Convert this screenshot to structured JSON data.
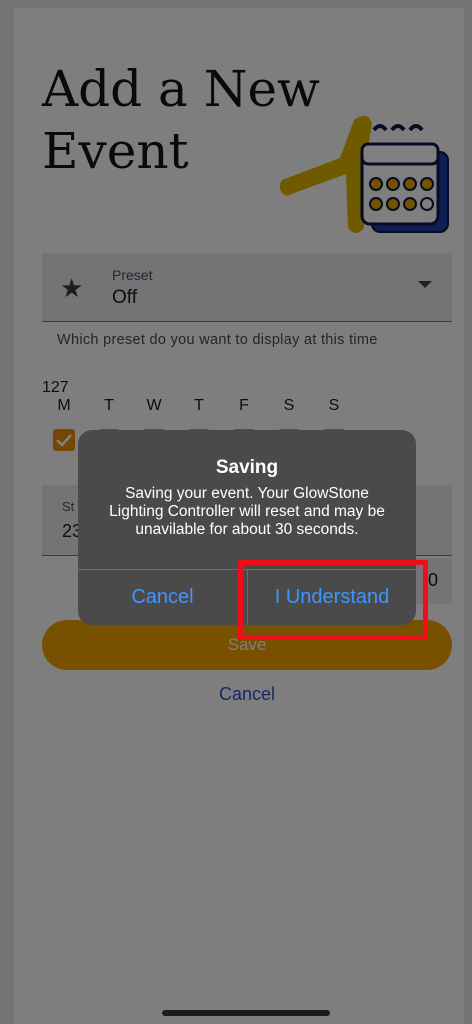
{
  "page": {
    "title_line1": "Add a New",
    "title_line2": "Event"
  },
  "hero_icon": "calendar-plus-icon",
  "preset": {
    "label": "Preset",
    "value": "Off",
    "icon": "star-icon",
    "helper": "Which preset do you want to display at this time"
  },
  "days": {
    "count": "127",
    "labels": [
      "M",
      "T",
      "W",
      "T",
      "F",
      "S",
      "S"
    ]
  },
  "start": {
    "label": "St",
    "value": "23"
  },
  "end": {
    "value": "0"
  },
  "actions": {
    "save_label": "Save",
    "cancel_label": "Cancel"
  },
  "dialog": {
    "title": "Saving",
    "message": "Saving your event. Your GlowStone Lighting Controller will reset and may be unavilable for about 30 seconds.",
    "cancel_label": "Cancel",
    "confirm_label": "I Understand"
  },
  "colors": {
    "accent": "#f0a300",
    "checkbox": "#ea8f06",
    "link": "#2c4fd0",
    "dialog_button": "#3d96ff",
    "highlight": "#f10d17"
  }
}
